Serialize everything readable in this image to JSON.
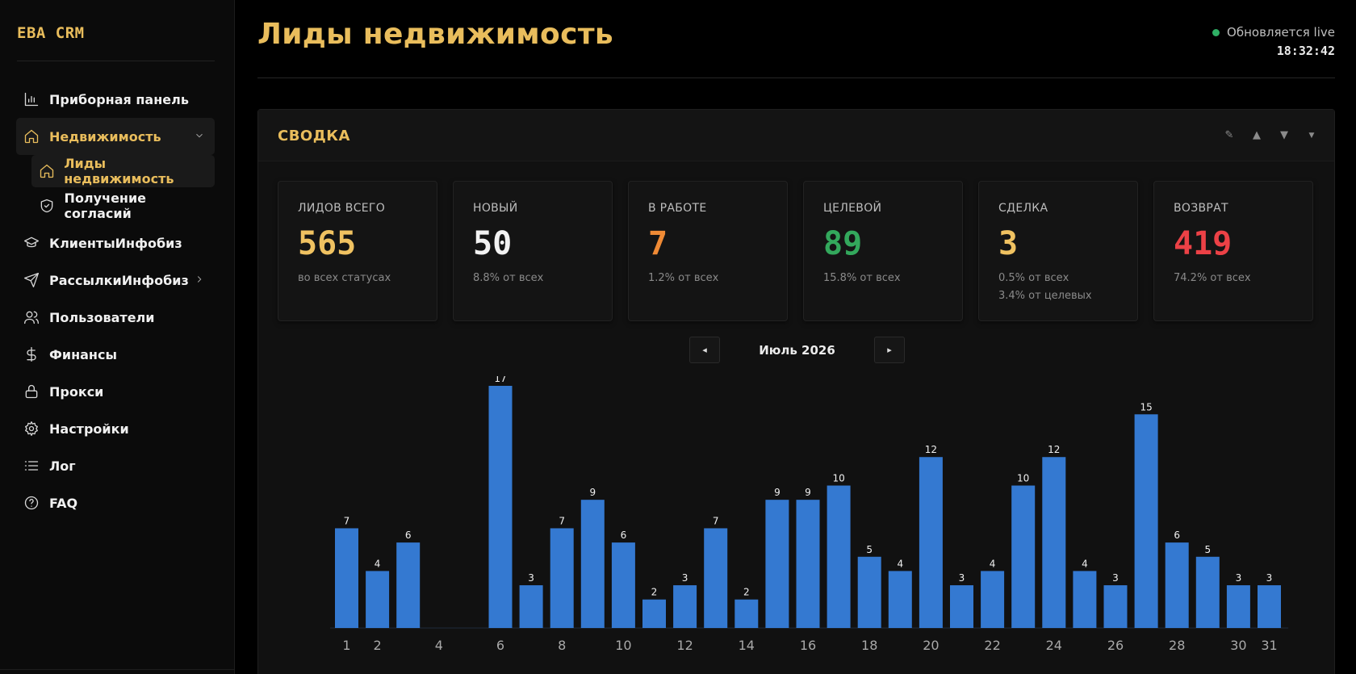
{
  "sidebar": {
    "brand": "EBA CRM",
    "items": [
      {
        "label": "Приборная панель",
        "icon": "bar-chart-icon"
      },
      {
        "label": "Недвижимость",
        "icon": "home-icon"
      },
      {
        "label": "КлиентыИнфобиз",
        "icon": "graduation-cap-icon"
      },
      {
        "label": "РассылкиИнфобиз",
        "icon": "send-icon"
      },
      {
        "label": "Пользователи",
        "icon": "users-icon"
      },
      {
        "label": "Финансы",
        "icon": "dollar-icon"
      },
      {
        "label": "Прокси",
        "icon": "lock-icon"
      },
      {
        "label": "Настройки",
        "icon": "gear-icon"
      },
      {
        "label": "Лог",
        "icon": "list-icon"
      },
      {
        "label": "FAQ",
        "icon": "help-circle-icon"
      }
    ],
    "subitems": [
      {
        "label": "Лиды недвижимость",
        "icon": "home-icon"
      },
      {
        "label": "Получение согласий",
        "icon": "shield-check-icon"
      }
    ]
  },
  "header": {
    "title": "Лиды недвижимость",
    "live_text": "Обновляется live",
    "clock": "18:32:42"
  },
  "panel": {
    "title": "СВОДКА",
    "tools": [
      "edit-icon",
      "move-up-icon",
      "move-down-icon",
      "collapse-icon"
    ]
  },
  "stats": [
    {
      "label": "ЛИДОВ ВСЕГО",
      "value": "565",
      "sub1": "во всех статусах",
      "sub2": "",
      "color": "#f0c261"
    },
    {
      "label": "НОВЫЙ",
      "value": "50",
      "sub1": "8.8% от всех",
      "sub2": "",
      "color": "#f2f2f2"
    },
    {
      "label": "В РАБОТЕ",
      "value": "7",
      "sub1": "1.2% от всех",
      "sub2": "",
      "color": "#ef8a35"
    },
    {
      "label": "ЦЕЛЕВОЙ",
      "value": "89",
      "sub1": "15.8% от всех",
      "sub2": "",
      "color": "#33a85c"
    },
    {
      "label": "СДЕЛКА",
      "value": "3",
      "sub1": "0.5% от всех",
      "sub2": "3.4% от целевых",
      "color": "#f0c261"
    },
    {
      "label": "ВОЗВРАТ",
      "value": "419",
      "sub1": "74.2% от всех",
      "sub2": "",
      "color": "#ec4146"
    }
  ],
  "month_nav": {
    "prev": "◂",
    "next": "▸",
    "label": "Июль 2026"
  },
  "chart_data": {
    "type": "bar",
    "categories": [
      "1",
      "2",
      "3",
      "4",
      "5",
      "6",
      "7",
      "8",
      "9",
      "10",
      "11",
      "12",
      "13",
      "14",
      "15",
      "16",
      "17",
      "18",
      "19",
      "20",
      "21",
      "22",
      "23",
      "24",
      "25",
      "26",
      "27",
      "28",
      "29",
      "30",
      "31"
    ],
    "values": [
      7,
      4,
      6,
      0,
      0,
      17,
      3,
      7,
      9,
      6,
      2,
      3,
      7,
      2,
      9,
      9,
      10,
      5,
      4,
      12,
      3,
      4,
      10,
      12,
      4,
      3,
      15,
      6,
      5,
      3,
      3
    ],
    "tick_labels": [
      "1",
      "2",
      "4",
      "6",
      "8",
      "10",
      "12",
      "14",
      "16",
      "18",
      "20",
      "22",
      "24",
      "26",
      "28",
      "30",
      "31"
    ],
    "bar_color": "#3479d1",
    "ylim": [
      0,
      17
    ],
    "grid": false,
    "title": "",
    "xlabel": "",
    "ylabel": ""
  }
}
